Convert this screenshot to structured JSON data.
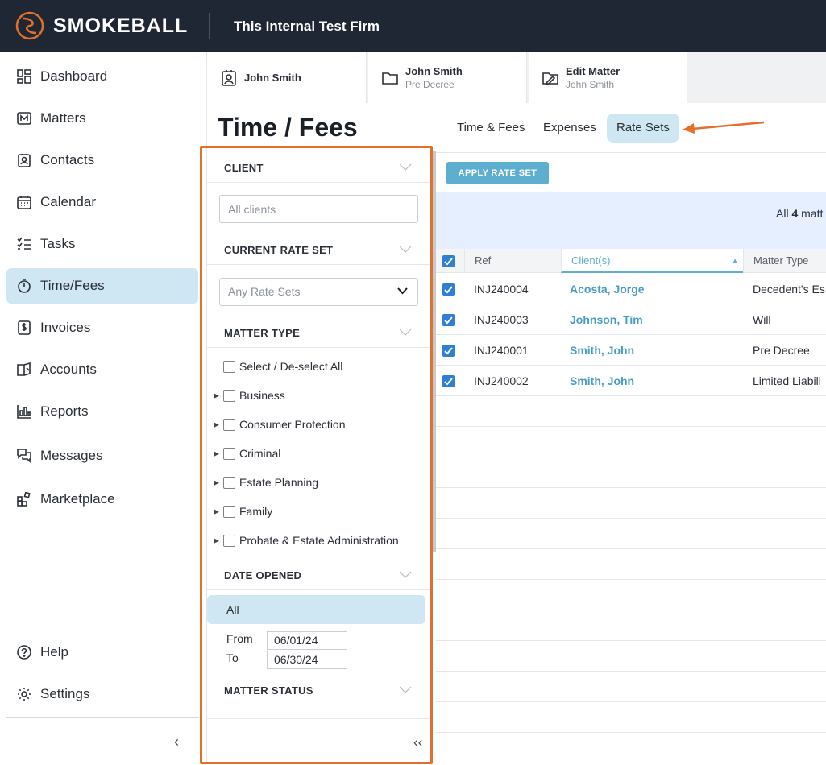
{
  "app": {
    "brand": "SMOKEBALL",
    "firm_name": "This Internal Test Firm",
    "accent": "#5eaecf",
    "annotation_color": "#e0702a"
  },
  "sidebar": {
    "items": [
      {
        "label": "Dashboard",
        "icon": "dashboard-icon"
      },
      {
        "label": "Matters",
        "icon": "matters-icon"
      },
      {
        "label": "Contacts",
        "icon": "contacts-icon"
      },
      {
        "label": "Calendar",
        "icon": "calendar-icon"
      },
      {
        "label": "Tasks",
        "icon": "tasks-icon"
      },
      {
        "label": "Time/Fees",
        "icon": "stopwatch-icon",
        "active": true
      },
      {
        "label": "Invoices",
        "icon": "invoice-icon"
      },
      {
        "label": "Accounts",
        "icon": "accounts-icon"
      },
      {
        "label": "Reports",
        "icon": "reports-icon"
      },
      {
        "label": "Messages",
        "icon": "messages-icon"
      },
      {
        "label": "Marketplace",
        "icon": "marketplace-icon"
      }
    ],
    "bottom": [
      {
        "label": "Help",
        "icon": "help-icon"
      },
      {
        "label": "Settings",
        "icon": "gear-icon"
      }
    ],
    "collapse_glyph": "‹"
  },
  "matter_tabs": [
    {
      "title": "John Smith",
      "subtitle": "",
      "icon": "contact-card-icon"
    },
    {
      "title": "John Smith",
      "subtitle": "Pre Decree",
      "icon": "folder-icon"
    },
    {
      "title": "Edit Matter",
      "subtitle": "John Smith",
      "icon": "folder-edit-icon"
    }
  ],
  "page": {
    "title": "Time / Fees",
    "tabs": [
      "Time & Fees",
      "Expenses",
      "Rate Sets"
    ],
    "active_tab": "Rate Sets"
  },
  "filters": {
    "client": {
      "heading": "CLIENT",
      "placeholder": "All clients"
    },
    "rate_set": {
      "heading": "CURRENT RATE SET",
      "selected": "Any Rate Sets"
    },
    "matter_type": {
      "heading": "MATTER TYPE",
      "select_all": "Select / De-select All",
      "options": [
        "Business",
        "Consumer Protection",
        "Criminal",
        "Estate Planning",
        "Family",
        "Probate & Estate Administration"
      ]
    },
    "date_opened": {
      "heading": "DATE OPENED",
      "selected": "All",
      "from_label": "From",
      "from_value": "06/01/24",
      "to_label": "To",
      "to_value": "06/30/24"
    },
    "matter_status": {
      "heading": "MATTER STATUS"
    },
    "collapse_glyph": "‹‹"
  },
  "toolbar": {
    "apply_label": "APPLY RATE SET"
  },
  "banner": {
    "prefix": "All ",
    "count": "4",
    "suffix": " matt"
  },
  "grid": {
    "columns": [
      "Ref",
      "Client(s)",
      "Matter Type"
    ],
    "sort_indicator": "▲",
    "rows": [
      {
        "ref": "INJ240004",
        "client": "Acosta, Jorge",
        "type": "Decedent's Es",
        "checked": true
      },
      {
        "ref": "INJ240003",
        "client": "Johnson, Tim",
        "type": "Will",
        "checked": true
      },
      {
        "ref": "INJ240001",
        "client": "Smith, John",
        "type": "Pre Decree",
        "checked": true
      },
      {
        "ref": "INJ240002",
        "client": "Smith, John",
        "type": "Limited Liabili",
        "checked": true
      }
    ]
  }
}
